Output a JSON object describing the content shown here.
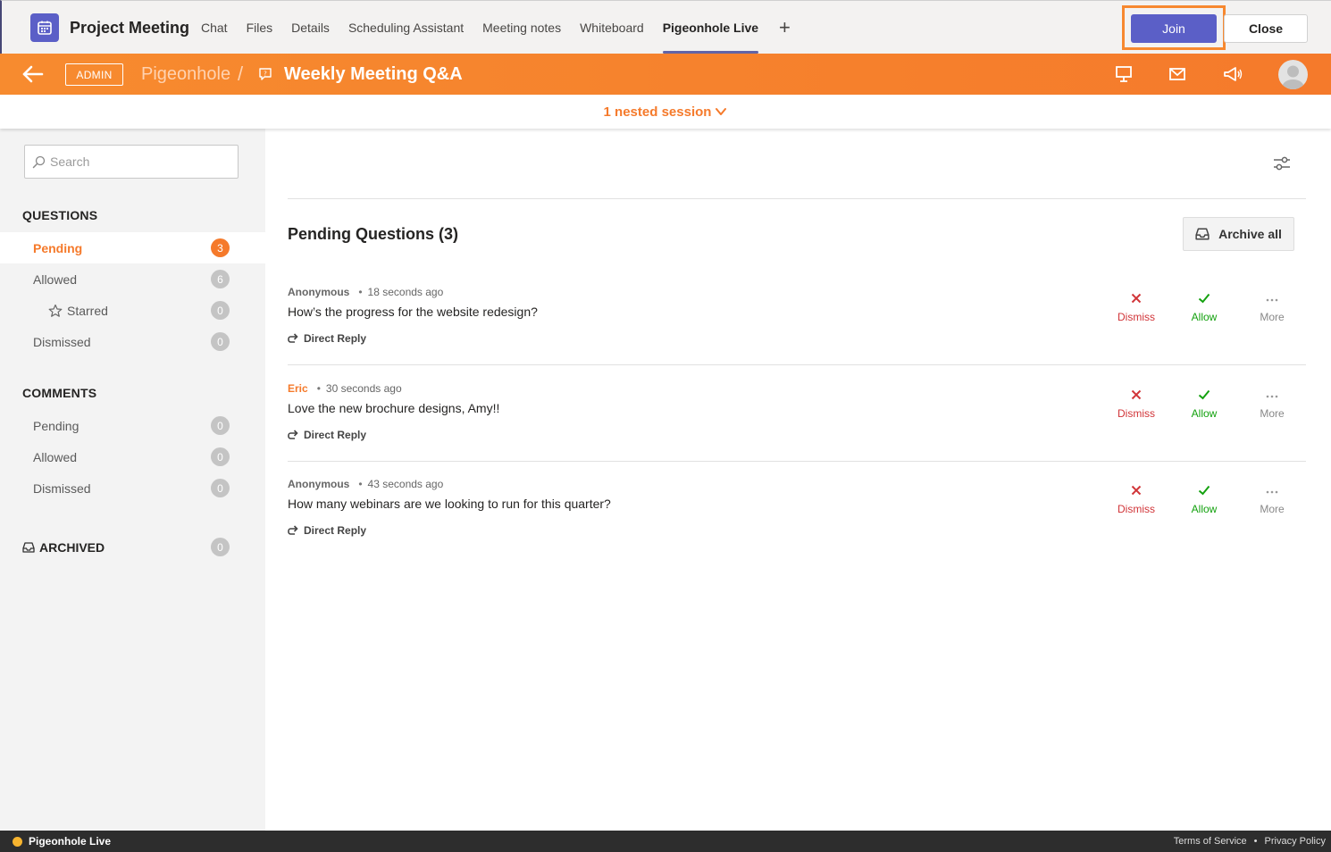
{
  "teams": {
    "meeting_title": "Project Meeting",
    "tabs": [
      {
        "label": "Chat",
        "active": false
      },
      {
        "label": "Files",
        "active": false
      },
      {
        "label": "Details",
        "active": false
      },
      {
        "label": "Scheduling Assistant",
        "active": false
      },
      {
        "label": "Meeting notes",
        "active": false
      },
      {
        "label": "Whiteboard",
        "active": false
      },
      {
        "label": "Pigeonhole Live",
        "active": true
      }
    ],
    "add_tab": "+",
    "join_label": "Join",
    "close_label": "Close",
    "accent": "#5b5fc7"
  },
  "pigeonhole": {
    "admin_badge": "ADMIN",
    "brand": "Pigeonhole",
    "separator": "/",
    "session_title": "Weekly Meeting Q&A",
    "nested_session": "1 nested session",
    "accent": "#f57a2b"
  },
  "sidebar": {
    "search_placeholder": "Search",
    "questions_title": "QUESTIONS",
    "questions": [
      {
        "label": "Pending",
        "count": "3",
        "active": true
      },
      {
        "label": "Allowed",
        "count": "6",
        "active": false
      },
      {
        "label": "Starred",
        "count": "0",
        "active": false
      },
      {
        "label": "Dismissed",
        "count": "0",
        "active": false
      }
    ],
    "comments_title": "COMMENTS",
    "comments": [
      {
        "label": "Pending",
        "count": "0"
      },
      {
        "label": "Allowed",
        "count": "0"
      },
      {
        "label": "Dismissed",
        "count": "0"
      }
    ],
    "archived_title": "ARCHIVED",
    "archived_count": "0"
  },
  "main": {
    "heading": "Pending Questions (3)",
    "archive_all": "Archive all",
    "actions": {
      "dismiss": "Dismiss",
      "allow": "Allow",
      "more": "More",
      "reply": "Direct Reply"
    },
    "questions": [
      {
        "author": "Anonymous",
        "time": "18 seconds ago",
        "text": "How’s the progress for the website redesign?"
      },
      {
        "author": "Eric",
        "time": "30 seconds ago",
        "text": "Love the new brochure designs, Amy!!"
      },
      {
        "author": "Anonymous",
        "time": "43 seconds ago",
        "text": "How many webinars are we looking to run for this quarter?"
      }
    ]
  },
  "footer": {
    "brand": "Pigeonhole Live",
    "terms": "Terms of Service",
    "dot": "•",
    "privacy": "Privacy Policy"
  },
  "icons": [
    "calendar-icon",
    "back-arrow-icon",
    "question-bubble-icon",
    "presentation-icon",
    "mail-icon",
    "megaphone-icon",
    "avatar-icon",
    "chevron-down-icon",
    "search-icon",
    "star-icon",
    "archive-icon",
    "settings-sliders-icon",
    "close-x-icon",
    "check-icon",
    "more-dots-icon",
    "reply-icon"
  ]
}
